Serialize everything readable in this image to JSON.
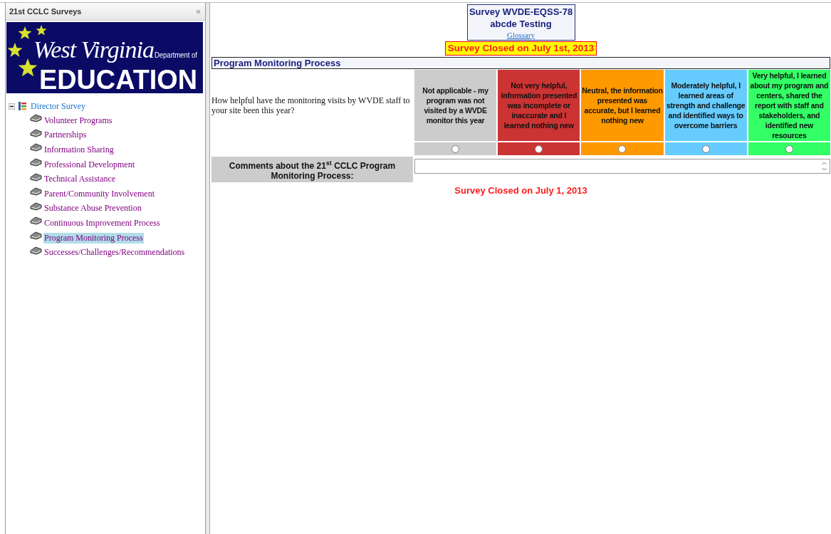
{
  "sidebar": {
    "title": "21st CCLC Surveys",
    "collapse_glyph": "«",
    "logo": {
      "line_1": "West Virginia",
      "line_2": "Department of",
      "line_3": "EDUCATION"
    },
    "tree": [
      {
        "label": "Director Survey",
        "expanded": true,
        "children": [
          {
            "label": "Volunteer Programs",
            "selected": false
          },
          {
            "label": "Partnerships",
            "selected": false
          },
          {
            "label": "Information Sharing",
            "selected": false
          },
          {
            "label": "Professional Development",
            "selected": false
          },
          {
            "label": "Technical Assistance",
            "selected": false
          },
          {
            "label": "Parent/Community Involvement",
            "selected": false
          },
          {
            "label": "Substance Abuse Prevention",
            "selected": false
          },
          {
            "label": "Continuous Improvement Process",
            "selected": false
          },
          {
            "label": "Program Monitoring Process",
            "selected": true
          },
          {
            "label": "Successes/Challenges/Recommendations",
            "selected": false
          }
        ]
      }
    ]
  },
  "survey": {
    "title_line_1": "Survey WVDE-EQSS-78",
    "title_line_2": "abcde Testing",
    "glossary_link": "Glossary",
    "closed_banner": "Survey Closed on July 1st, 2013",
    "section": "Program Monitoring Process",
    "question": "How helpful have the monitoring visits by WVDE staff to your site been this year?",
    "options": [
      {
        "label": "Not applicable - my program was not visited by a WVDE monitor this year",
        "color": "#cccccc",
        "selected": false
      },
      {
        "label": "Not very helpful, information presented was incomplete or inaccurate and I learned nothing new",
        "color": "#cc3333",
        "selected": false
      },
      {
        "label": "Neutral, the information presented was accurate, but I learned nothing new",
        "color": "#ff9900",
        "selected": false
      },
      {
        "label": "Moderately helpful, I learned areas of strength and challenge and identified ways to overcome barriers",
        "color": "#66ccff",
        "selected": false
      },
      {
        "label": "Very helpful, I learned about my program and centers, shared the report with staff and stakeholders, and identified new resources",
        "color": "#33ff66",
        "selected": false
      }
    ],
    "comments_label": "Comments about the 21$^{st}$ CCLC Program Monitoring Process:",
    "closed_footer": "Survey Closed on July 1, 2013"
  }
}
